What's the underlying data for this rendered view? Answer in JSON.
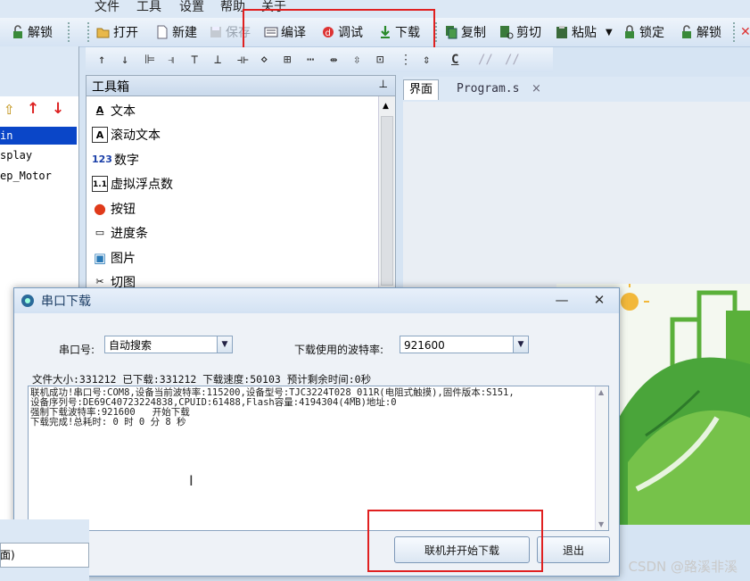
{
  "menu": {
    "file": "文件",
    "tools": "工具",
    "settings": "设置",
    "help": "帮助",
    "about": "关于"
  },
  "toolbar": {
    "unlock_left": "解锁",
    "open": "打开",
    "new": "新建",
    "save": "保存",
    "compile": "编译",
    "debug": "调试",
    "download": "下载",
    "copy": "复制",
    "cut": "剪切",
    "paste": "粘贴",
    "lock": "锁定",
    "unlock": "解锁",
    "format_c": "C"
  },
  "tree": {
    "items": [
      "in",
      "splay",
      "ep_Motor"
    ]
  },
  "toolbox": {
    "title": "工具箱",
    "pin": "⊥",
    "items": [
      {
        "icon": "A",
        "label": "文本"
      },
      {
        "icon": "A",
        "label": "滚动文本"
      },
      {
        "icon": "123",
        "label": "数字"
      },
      {
        "icon": "1.1",
        "label": "虚拟浮点数"
      },
      {
        "icon": "●",
        "label": "按钮"
      },
      {
        "icon": "▭",
        "label": "进度条"
      },
      {
        "icon": "▣",
        "label": "图片"
      },
      {
        "icon": "✂",
        "label": "切图"
      }
    ]
  },
  "tabs": {
    "interface": "界面",
    "program": "Program.s",
    "close": "×"
  },
  "dialog": {
    "title": "串口下载",
    "port_label": "串口号:",
    "port_value": "自动搜索",
    "baud_label": "下载使用的波特率:",
    "baud_value": "921600",
    "status": "文件大小:331212  已下载:331212  下载速度:50103  预计剩余时间:0秒",
    "log": [
      "联机成功!串口号:COM8,设备当前波特率:115200,设备型号:TJC3224T028_011R(电阻式触摸),固件版本:S151,",
      "设备序列号:DE69C40723224838,CPUID:61488,Flash容量:4194304(4MB)地址:0",
      "强制下载波特率:921600   开始下载",
      "下载完成!总耗时: 0 时 0 分 8 秒"
    ],
    "connect_button": "联机并开始下载",
    "exit_button": "退出",
    "minimize": "—",
    "close": "✕"
  },
  "bottom_left": "面)",
  "watermark": "CSDN @路溪非溪",
  "colors": {
    "accent_red": "#e02020",
    "selection": "#0a46c8"
  }
}
